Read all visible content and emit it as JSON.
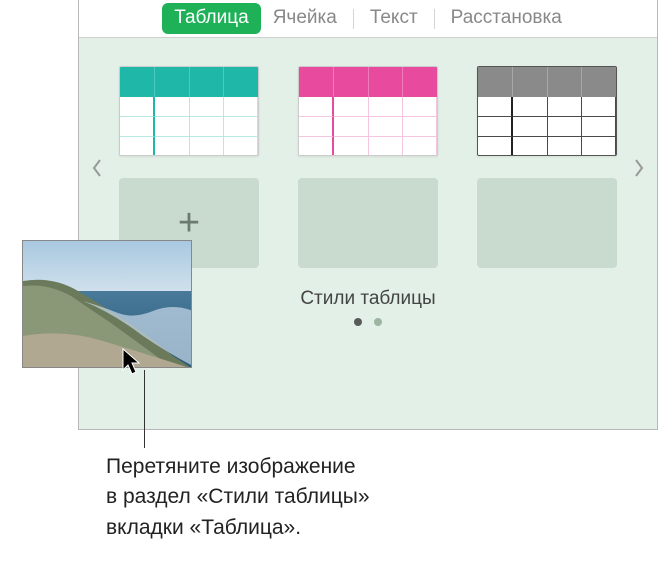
{
  "tabs": {
    "table": "Таблица",
    "cell": "Ячейка",
    "text": "Текст",
    "arrange": "Расстановка"
  },
  "styles": {
    "section_label": "Стили таблицы",
    "thumbs": [
      "teal",
      "pink",
      "gray"
    ],
    "add_icon": "+"
  },
  "callout": {
    "line1": "Перетяните изображение",
    "line2": "в раздел «Стили таблицы»",
    "line3": "вкладки «Таблица»."
  }
}
